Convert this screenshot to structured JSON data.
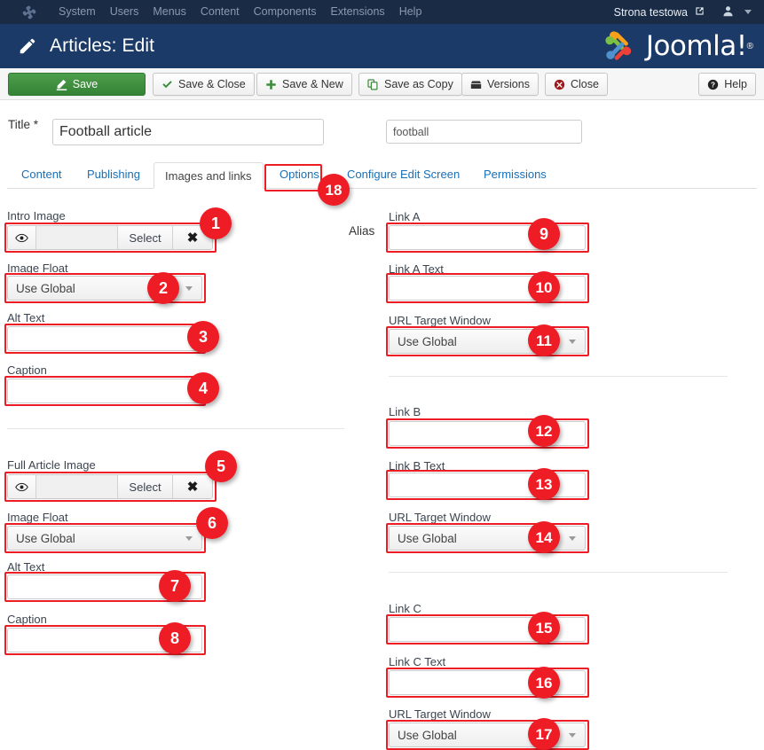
{
  "topnav": {
    "logo_icon": "joomla-logo-icon",
    "items": [
      {
        "label": "System"
      },
      {
        "label": "Users"
      },
      {
        "label": "Menus"
      },
      {
        "label": "Content"
      },
      {
        "label": "Components"
      },
      {
        "label": "Extensions"
      },
      {
        "label": "Help"
      }
    ],
    "site_name": "Strona testowa",
    "external_icon": "external-link-icon",
    "user_icon": "user-icon",
    "caret_icon": "chevron-down-icon"
  },
  "header": {
    "icon": "pencil-icon",
    "title": "Articles: Edit",
    "brand": "Joomla!",
    "brand_reg": "®"
  },
  "toolbar": {
    "save": "Save",
    "save_close": "Save & Close",
    "save_new": "Save & New",
    "save_copy": "Save as Copy",
    "versions": "Versions",
    "close": "Close",
    "help": "Help",
    "primary_color": "#3c8a3c"
  },
  "form_head": {
    "title_label": "Title *",
    "title_value": "Football article",
    "alias_label": "Alias",
    "alias_value": "football"
  },
  "tabs": [
    {
      "label": "Content",
      "active": false
    },
    {
      "label": "Publishing",
      "active": false
    },
    {
      "label": "Images and links",
      "active": true
    },
    {
      "label": "Options",
      "active": false
    },
    {
      "label": "Configure Edit Screen",
      "active": false
    },
    {
      "label": "Permissions",
      "active": false
    }
  ],
  "image_widget": {
    "eye_icon": "eye-icon",
    "select_label": "Select",
    "clear_icon": "close-x-icon",
    "path_value": ""
  },
  "left_column": {
    "intro_image_label": "Intro Image",
    "intro_float_label": "Image Float",
    "intro_float_value": "Use Global",
    "intro_alt_label": "Alt Text",
    "intro_alt_value": "",
    "intro_caption_label": "Caption",
    "intro_caption_value": "",
    "full_image_label": "Full Article Image",
    "full_float_label": "Image Float",
    "full_float_value": "Use Global",
    "full_alt_label": "Alt Text",
    "full_alt_value": "",
    "full_caption_label": "Caption",
    "full_caption_value": ""
  },
  "right_column": {
    "link_a_label": "Link A",
    "link_a_value": "",
    "link_a_text_label": "Link A Text",
    "link_a_text_value": "",
    "link_a_target_label": "URL Target Window",
    "link_a_target_value": "Use Global",
    "link_b_label": "Link B",
    "link_b_value": "",
    "link_b_text_label": "Link B Text",
    "link_b_text_value": "",
    "link_b_target_label": "URL Target Window",
    "link_b_target_value": "Use Global",
    "link_c_label": "Link C",
    "link_c_value": "",
    "link_c_text_label": "Link C Text",
    "link_c_text_value": "",
    "link_c_target_label": "URL Target Window",
    "link_c_target_value": "Use Global"
  },
  "annotations": {
    "color": "#ee1c25",
    "badges": [
      {
        "n": "1"
      },
      {
        "n": "2"
      },
      {
        "n": "3"
      },
      {
        "n": "4"
      },
      {
        "n": "5"
      },
      {
        "n": "6"
      },
      {
        "n": "7"
      },
      {
        "n": "8"
      },
      {
        "n": "9"
      },
      {
        "n": "10"
      },
      {
        "n": "11"
      },
      {
        "n": "12"
      },
      {
        "n": "13"
      },
      {
        "n": "14"
      },
      {
        "n": "15"
      },
      {
        "n": "16"
      },
      {
        "n": "17"
      },
      {
        "n": "18"
      }
    ]
  }
}
